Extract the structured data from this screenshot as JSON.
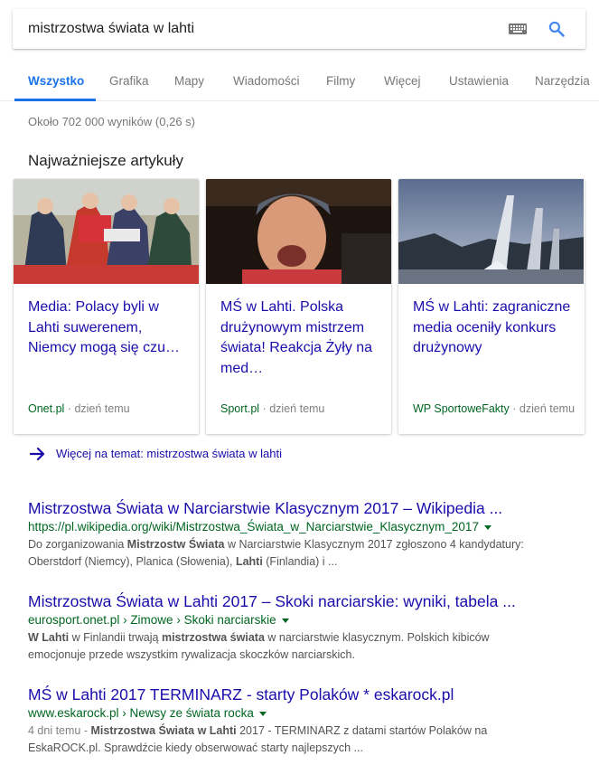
{
  "search": {
    "query": "mistrzostwa świata w lahti"
  },
  "tabs": [
    {
      "label": "Wszystko",
      "active": true
    },
    {
      "label": "Grafika"
    },
    {
      "label": "Mapy"
    },
    {
      "label": "Wiadomości"
    },
    {
      "label": "Filmy"
    },
    {
      "label": "Więcej"
    },
    {
      "label": "Ustawienia"
    },
    {
      "label": "Narzędzia"
    }
  ],
  "stats": "Około 702 000 wyników (0,26 s)",
  "top_stories": {
    "title": "Najważniejsze artykuły",
    "cards": [
      {
        "title": "Media: Polacy byli w Lahti suwerenem, Niemcy mogą się czu…",
        "source": "Onet.pl",
        "separator": "·",
        "time": "dzień temu"
      },
      {
        "title": "MŚ w Lahti. Polska drużynowym mistrzem świata! Reakcja Żyły na med…",
        "source": "Sport.pl",
        "separator": "·",
        "time": "dzień temu"
      },
      {
        "title": "MŚ w Lahti: zagraniczne media oceniły konkurs drużynowy",
        "source": "WP SportoweFakty",
        "separator": "·",
        "time": "dzień temu"
      }
    ],
    "more_label": "Więcej na temat: mistrzostwa świata w lahti"
  },
  "results": [
    {
      "title": "Mistrzostwa Świata w Narciarstwie Klasycznym 2017 – Wikipedia ...",
      "url": "https://pl.wikipedia.org/wiki/Mistrzostwa_Świata_w_Narciarstwie_Klasycznym_2017",
      "snippet_1": "Do zorganizowania ",
      "snippet_1b": "Mistrzostw Świata",
      "snippet_1c": " w Narciarstwie Klasycznym 2017 zgłoszono 4 kandydatury:",
      "snippet_2": "Oberstdorf (Niemcy), Planica (Słowenia), ",
      "snippet_2b": "Lahti",
      "snippet_2c": " (Finlandia) i ..."
    },
    {
      "title": "Mistrzostwa Świata w Lahti 2017 – Skoki narciarskie: wyniki, tabela ...",
      "url": "eurosport.onet.pl › Zimowe › Skoki narciarskie",
      "snippet_1b": "W Lahti",
      "snippet_1": " w Finlandii trwają ",
      "snippet_1c": "mistrzostwa świata",
      "snippet_1d": " w narciarstwie klasycznym. Polskich kibiców",
      "snippet_2": "emocjonuje przede wszystkim rywalizacja skoczków narciarskich."
    },
    {
      "title": "MŚ w Lahti 2017 TERMINARZ - starty Polaków * eskarock.pl",
      "url": "www.eskarock.pl › Newsy ze świata rocka",
      "date": "4 dni temu - ",
      "snippet_1b": "Mistrzostwa Świata w Lahti",
      "snippet_1": " 2017 - TERMINARZ z datami startów Polaków na",
      "snippet_2": "EskaROCK.pl. Sprawdźcie kiedy obserwować starty najlepszych ..."
    }
  ]
}
